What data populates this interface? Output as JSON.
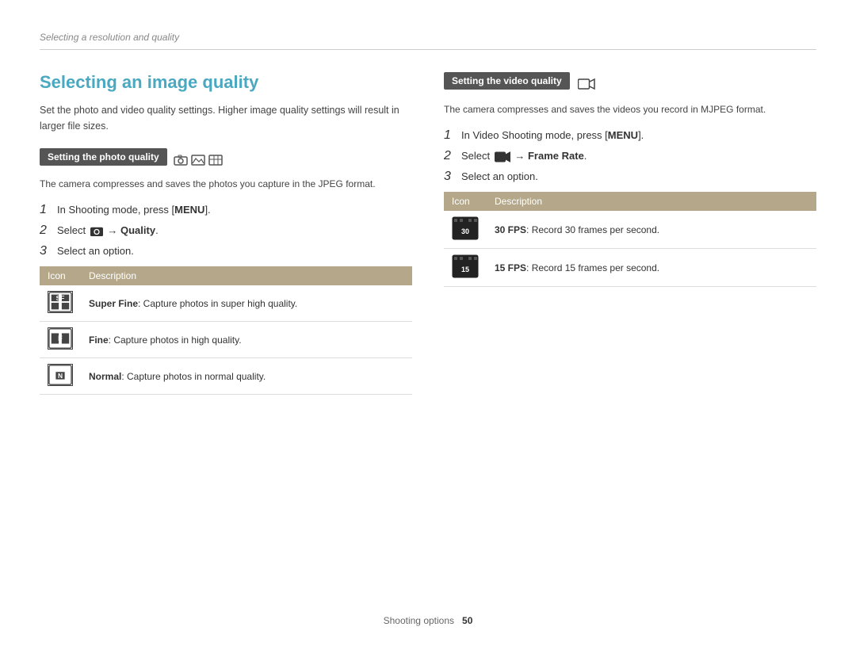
{
  "breadcrumb": {
    "text": "Selecting a resolution and quality"
  },
  "left": {
    "title": "Selecting an image quality",
    "intro": "Set the photo and video quality settings. Higher image quality settings will result in larger file sizes.",
    "photo_section": {
      "label": "Setting the photo quality",
      "description": "The camera compresses and saves the photos you capture in the JPEG format.",
      "steps": [
        "In Shooting mode, press [MENU].",
        "Select  → Quality.",
        "Select an option."
      ],
      "table_headers": [
        "Icon",
        "Description"
      ],
      "rows": [
        {
          "icon_label": "SF",
          "description_bold": "Super Fine",
          "description_rest": ": Capture photos in super high quality."
        },
        {
          "icon_label": "F",
          "description_bold": "Fine",
          "description_rest": ": Capture photos in high quality."
        },
        {
          "icon_label": "N",
          "description_bold": "Normal",
          "description_rest": ": Capture photos in normal quality."
        }
      ]
    }
  },
  "right": {
    "video_section": {
      "label": "Setting the video quality",
      "description": "The camera compresses and saves the videos you record in MJPEG format.",
      "steps": [
        "In Video Shooting mode, press [MENU].",
        "Select  → Frame Rate.",
        "Select an option."
      ],
      "table_headers": [
        "Icon",
        "Description"
      ],
      "rows": [
        {
          "icon_label": "30",
          "description_bold": "30 FPS",
          "description_rest": ": Record 30 frames per second."
        },
        {
          "icon_label": "15",
          "description_bold": "15 FPS",
          "description_rest": ": Record 15 frames per second."
        }
      ]
    }
  },
  "footer": {
    "text": "Shooting options",
    "page_number": "50"
  }
}
